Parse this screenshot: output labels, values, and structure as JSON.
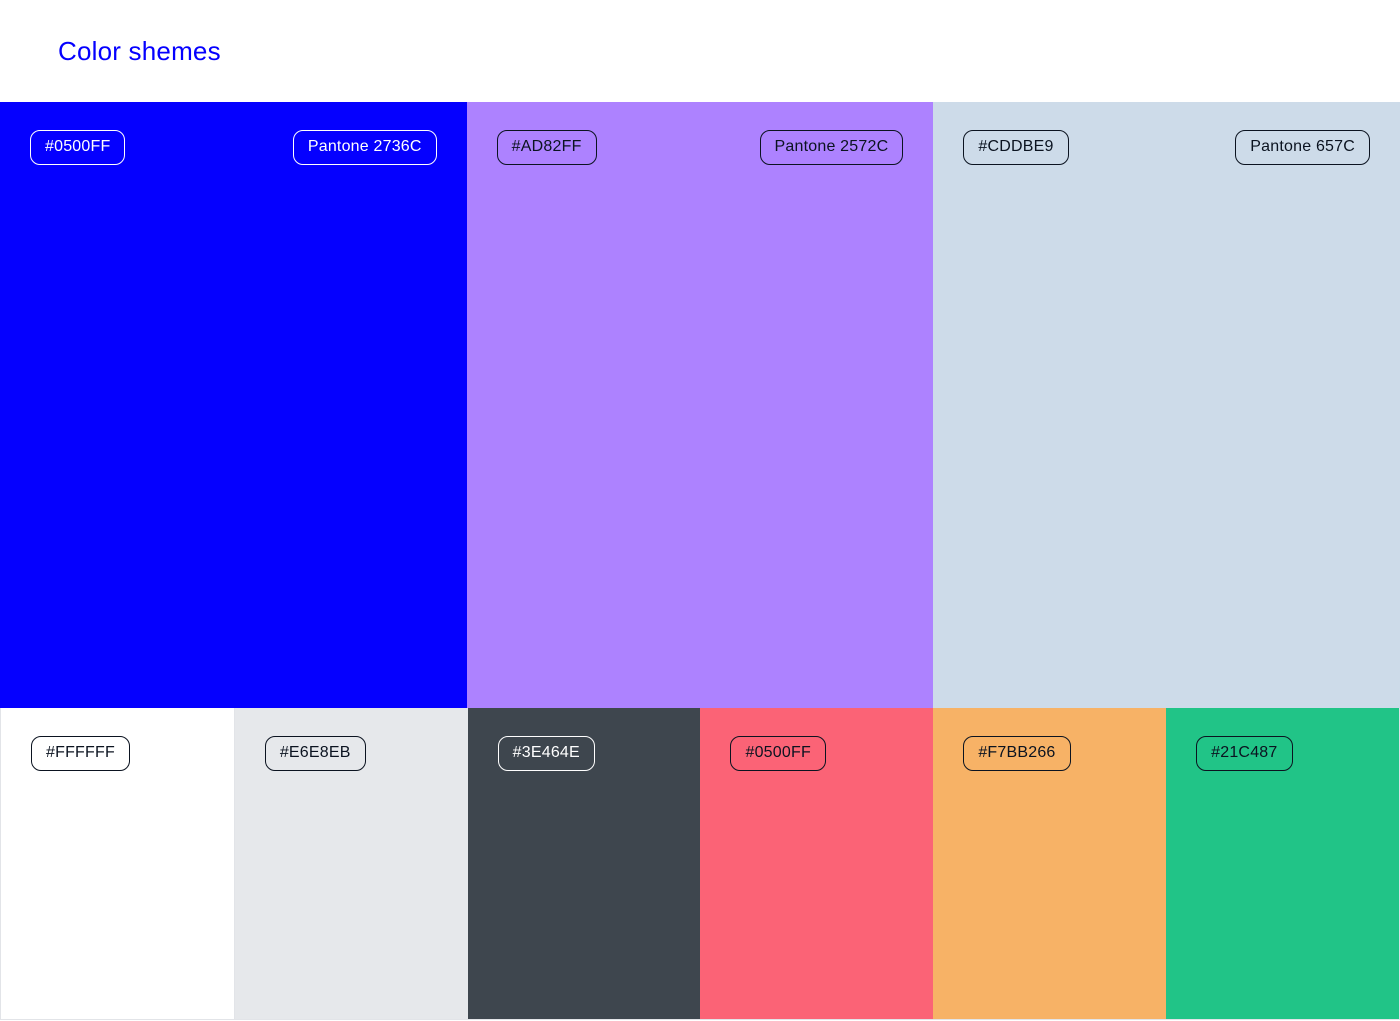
{
  "header": {
    "title": "Color shemes",
    "title_color": "#0500FF"
  },
  "primary": [
    {
      "hex": "#0500FF",
      "pantone": "Pantone 2736C",
      "bg": "#0500FF",
      "text": "light"
    },
    {
      "hex": "#AD82FF",
      "pantone": "Pantone 2572C",
      "bg": "#AD82FF",
      "text": "dark"
    },
    {
      "hex": "#CDDBE9",
      "pantone": "Pantone 657C",
      "bg": "#CDDBE9",
      "text": "dark"
    }
  ],
  "secondary": [
    {
      "hex": "#FFFFFF",
      "bg": "#FFFFFF",
      "text": "dark",
      "border_right": "#e2e4e8"
    },
    {
      "hex": "#E6E8EB",
      "bg": "#E6E8EB",
      "text": "dark"
    },
    {
      "hex": "#3E464E",
      "bg": "#3E464E",
      "text": "light"
    },
    {
      "hex": "#0500FF",
      "bg": "#FB6376",
      "text": "dark"
    },
    {
      "hex": "#F7BB266",
      "bg": "#F7B266",
      "text": "dark"
    },
    {
      "hex": "#21C487",
      "bg": "#21C487",
      "text": "dark"
    }
  ]
}
